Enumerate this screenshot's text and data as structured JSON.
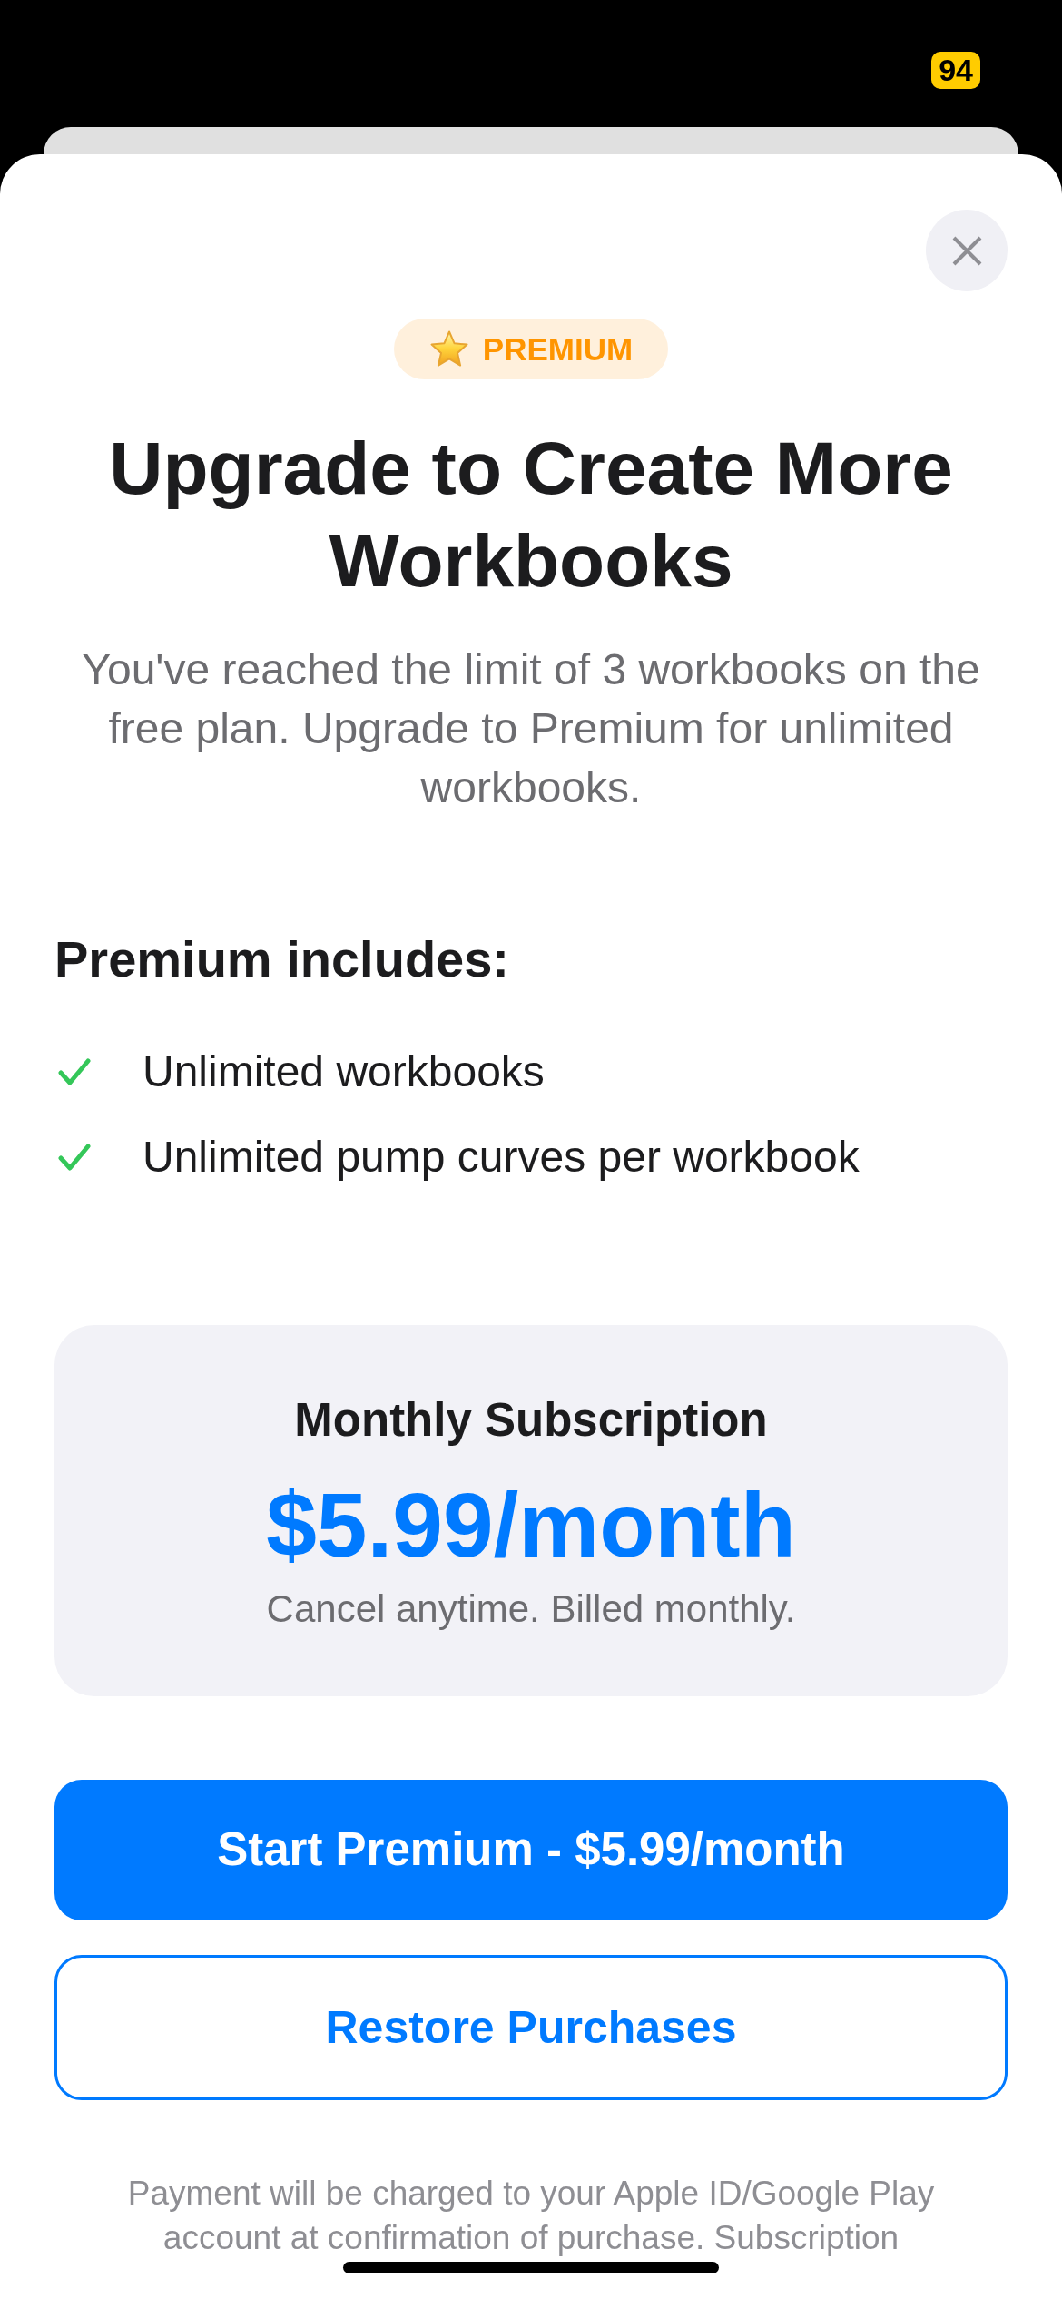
{
  "status_bar": {
    "battery": "94"
  },
  "badge": {
    "label": "PREMIUM"
  },
  "title": "Upgrade to Create More Workbooks",
  "description": "You've reached the limit of 3 workbooks on the free plan. Upgrade to Premium for unlimited workbooks.",
  "features": {
    "heading": "Premium includes:",
    "items": [
      "Unlimited workbooks",
      "Unlimited pump curves per workbook"
    ]
  },
  "plan": {
    "name": "Monthly Subscription",
    "price": "$5.99/month",
    "note": "Cancel anytime. Billed monthly."
  },
  "buttons": [
    {
      "kind": "primary",
      "label": "Start Premium - $5.99/month"
    },
    {
      "kind": "outline",
      "label": "Restore Purchases"
    }
  ],
  "legal": "Payment will be charged to your Apple ID/Google Play account at confirmation of purchase. Subscription"
}
